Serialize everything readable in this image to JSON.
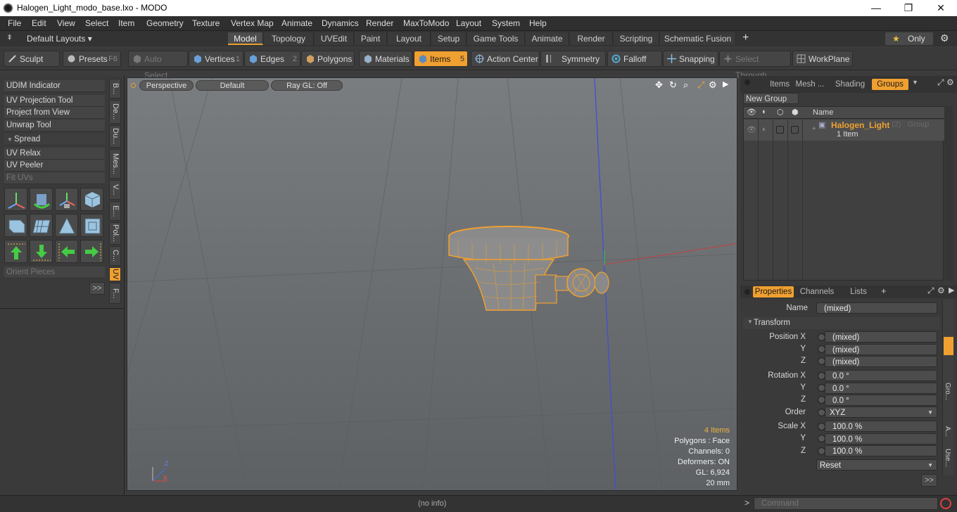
{
  "window": {
    "title": "Halogen_Light_modo_base.lxo - MODO",
    "minimize": "—",
    "maximize": "❐",
    "close": "✕"
  },
  "menu": [
    "File",
    "Edit",
    "View",
    "Select",
    "Item",
    "Geometry",
    "Texture",
    "Vertex Map",
    "Animate",
    "Dynamics",
    "Render",
    "MaxToModo",
    "Layout",
    "System",
    "Help"
  ],
  "layoutbar": {
    "layouts_label": "Default Layouts ▾",
    "tabs": [
      "Model",
      "Topology",
      "UVEdit",
      "Paint",
      "Layout",
      "Setup",
      "Game Tools",
      "Animate",
      "Render",
      "Scripting",
      "Schematic Fusion"
    ],
    "active_tab": "Model",
    "add": "+",
    "only_label": "Only"
  },
  "toolbar": {
    "sculpt": "Sculpt",
    "presets": "Presets",
    "presets_key": "F6",
    "auto_select": "Auto Select",
    "vertices": "Vertices",
    "vertices_key": "1",
    "edges": "Edges",
    "edges_key": "2",
    "polygons": "Polygons",
    "materials": "Materials",
    "items": "Items",
    "items_key": "5",
    "action_center": "Action Center",
    "symmetry": "Symmetry",
    "falloff": "Falloff",
    "snapping": "Snapping",
    "select_through": "Select Through",
    "workplane": "WorkPlane"
  },
  "left": {
    "udim": "UDIM Indicator",
    "uvproj": "UV Projection Tool",
    "projview": "Project from View",
    "unwrap": "Unwrap Tool",
    "spread": "Spread",
    "relax": "UV Relax",
    "peeler": "UV Peeler",
    "fituvs": "Fit UVs",
    "orient": "Orient Pieces",
    "more": ">>",
    "vtabs": [
      "B...",
      "De...",
      "Du...",
      "Mes...",
      "V...",
      "E...",
      "Pol...",
      "C...",
      "UV",
      "F..."
    ],
    "active_vtab": "UV"
  },
  "viewport": {
    "perspective": "Perspective",
    "default": "Default",
    "raygl": "Ray GL: Off",
    "stats": {
      "items": "4 Items",
      "polygons": "Polygons : Face",
      "channels": "Channels: 0",
      "deformers": "Deformers: ON",
      "gl": "GL: 6,924",
      "size": "20 mm"
    },
    "axis_z": "Z",
    "axis_x": "X"
  },
  "right": {
    "top_tabs": [
      "Items",
      "Mesh ...",
      "Shading",
      "Groups"
    ],
    "active_top_tab": "Groups",
    "new_group": "New Group",
    "col_name": "Name",
    "group_name": "Halogen_Light",
    "group_count": "(2) : Group",
    "group_items": "1 Item",
    "prop_tabs": [
      "Properties",
      "Channels",
      "Lists"
    ],
    "active_prop_tab": "Properties",
    "add": "+",
    "name_label": "Name",
    "name_value": "(mixed)",
    "transform": "Transform",
    "position_label": "Position X",
    "pos": [
      "(mixed)",
      "(mixed)",
      "(mixed)"
    ],
    "rotation_label": "Rotation X",
    "rot": [
      "0.0 °",
      "0.0 °",
      "0.0 °"
    ],
    "order_label": "Order",
    "order_value": "XYZ",
    "scale_label": "Scale X",
    "scale": [
      "100.0 %",
      "100.0 %",
      "100.0 %"
    ],
    "y": "Y",
    "z": "Z",
    "reset": "Reset",
    "more": ">>",
    "side_tabs": [
      "Gro...",
      "A...",
      "Use..."
    ]
  },
  "status": {
    "info": "(no info)",
    "command_placeholder": "Command",
    "prompt": ">"
  },
  "colors": {
    "accent": "#f0a030",
    "bg": "#3a3a3a",
    "mesh": "#f0a030"
  }
}
